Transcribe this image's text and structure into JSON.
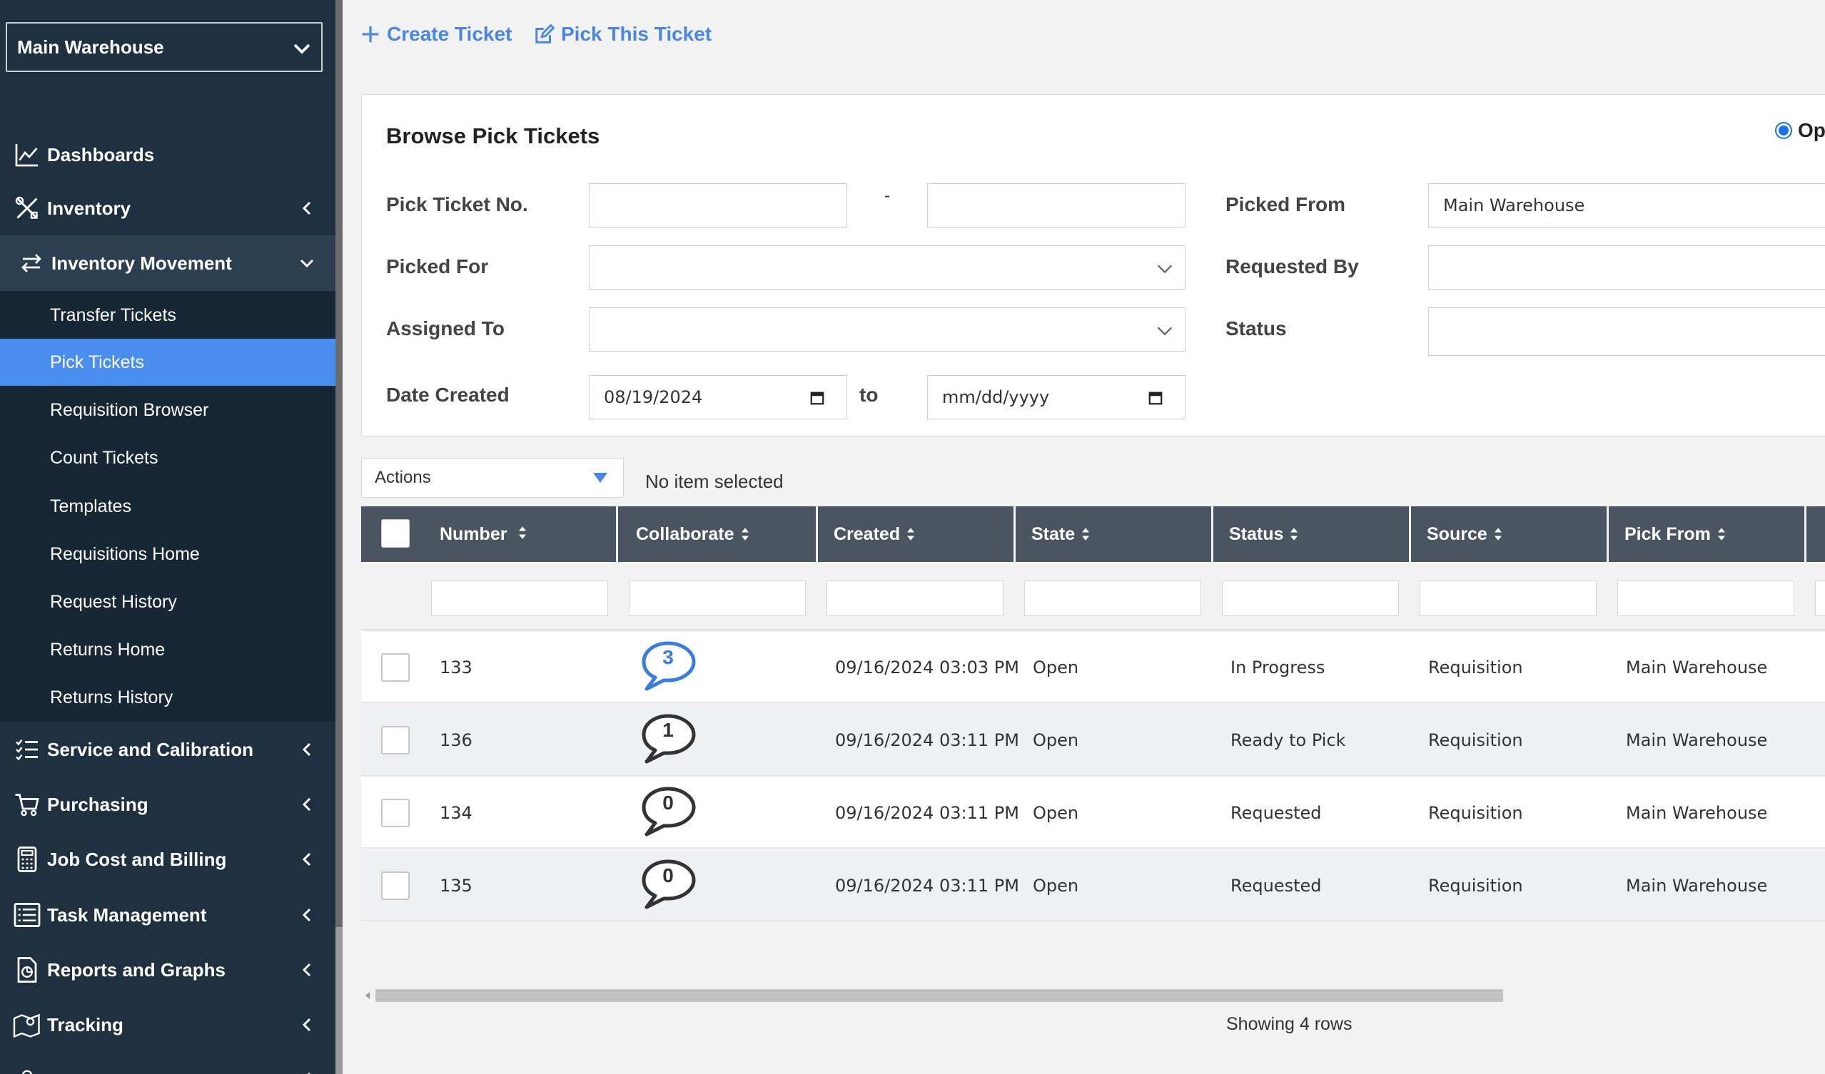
{
  "sidebar": {
    "warehouse_select": "Main Warehouse",
    "nav": [
      {
        "label": "Dashboards",
        "icon": "chart-line-icon"
      },
      {
        "label": "Inventory",
        "icon": "tools-icon"
      },
      {
        "label": "Inventory Movement",
        "icon": "transfer-arrows-icon"
      },
      {
        "label": "Service and Calibration",
        "icon": "checklist-icon"
      },
      {
        "label": "Purchasing",
        "icon": "cart-icon"
      },
      {
        "label": "Job Cost and Billing",
        "icon": "calculator-icon"
      },
      {
        "label": "Task Management",
        "icon": "list-icon"
      },
      {
        "label": "Reports and Graphs",
        "icon": "report-icon"
      },
      {
        "label": "Tracking",
        "icon": "map-pin-icon"
      }
    ],
    "sub_items": [
      "Transfer Tickets",
      "Pick Tickets",
      "Requisition Browser",
      "Count Tickets",
      "Templates",
      "Requisitions Home",
      "Request History",
      "Returns Home",
      "Returns History"
    ],
    "active_sub": "Pick Tickets"
  },
  "toolbar": {
    "create_label": "Create Ticket",
    "pick_label": "Pick This Ticket"
  },
  "browse": {
    "title": "Browse Pick Tickets",
    "radio_open": "Op",
    "labels": {
      "pick_ticket_no": "Pick Ticket No.",
      "picked_for": "Picked For",
      "assigned_to": "Assigned To",
      "date_created": "Date Created",
      "picked_from": "Picked From",
      "requested_by": "Requested By",
      "status": "Status",
      "dash": "-",
      "to": "to"
    },
    "values": {
      "picked_from": "Main Warehouse",
      "date_from": "08/19/2024",
      "date_to": "mm/dd/yyyy"
    }
  },
  "actions": {
    "label": "Actions",
    "selection_text": "No item selected"
  },
  "table": {
    "columns": [
      "Number",
      "Collaborate",
      "Created",
      "State",
      "Status",
      "Source",
      "Pick From"
    ],
    "rows": [
      {
        "number": "133",
        "collab": "3",
        "created": "09/16/2024 03:03 PM",
        "state": "Open",
        "status": "In Progress",
        "source": "Requisition",
        "pick_from": "Main Warehouse"
      },
      {
        "number": "136",
        "collab": "1",
        "created": "09/16/2024 03:11 PM",
        "state": "Open",
        "status": "Ready to Pick",
        "source": "Requisition",
        "pick_from": "Main Warehouse"
      },
      {
        "number": "134",
        "collab": "0",
        "created": "09/16/2024 03:11 PM",
        "state": "Open",
        "status": "Requested",
        "source": "Requisition",
        "pick_from": "Main Warehouse"
      },
      {
        "number": "135",
        "collab": "0",
        "created": "09/16/2024 03:11 PM",
        "state": "Open",
        "status": "Requested",
        "source": "Requisition",
        "pick_from": "Main Warehouse"
      }
    ],
    "footer": "Showing 4 rows"
  },
  "colors": {
    "sidebar_bg": "#1f3140",
    "active_item": "#4a8ff0",
    "link": "#4a86e8",
    "table_header": "#4a5561",
    "bubble_active": "#3b7ddd",
    "bubble_default": "#333333"
  }
}
